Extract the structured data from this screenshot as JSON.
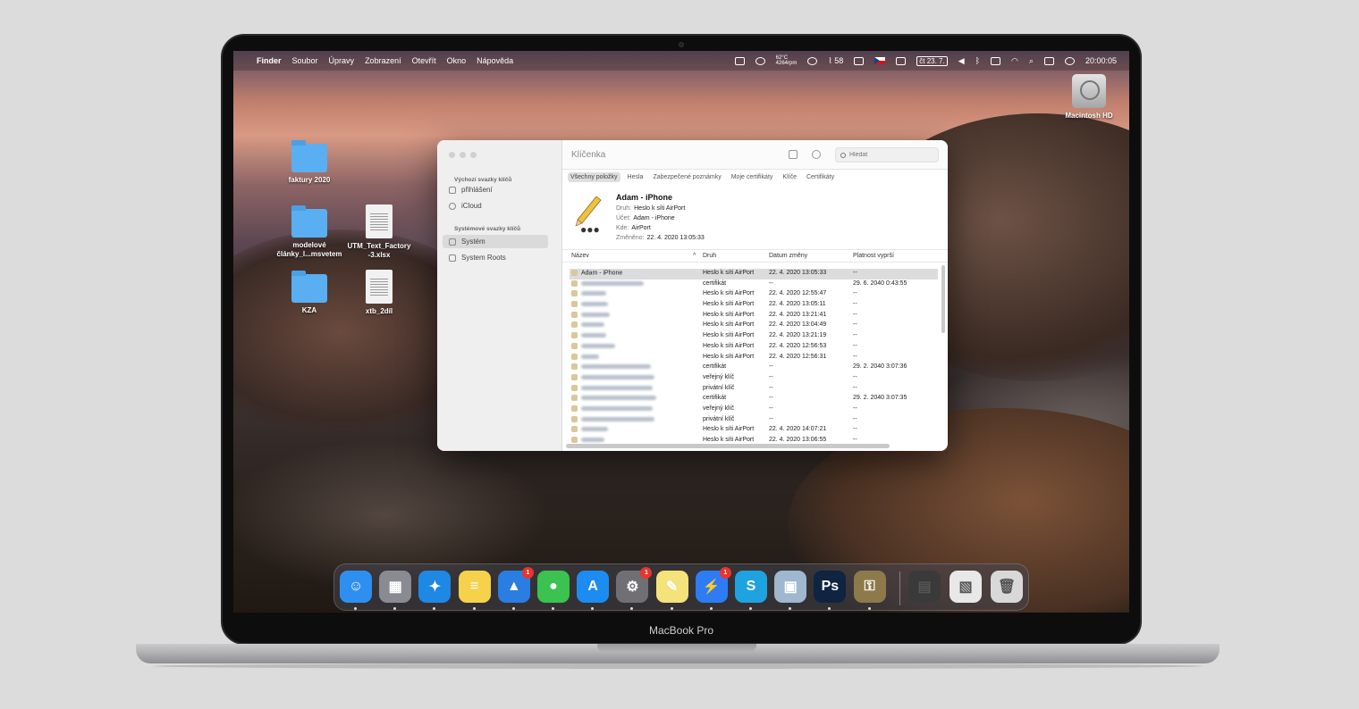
{
  "device": {
    "label": "MacBook Pro"
  },
  "menubar": {
    "apple": "",
    "app": "Finder",
    "menus": [
      "Soubor",
      "Úpravy",
      "Zobrazení",
      "Otevřít",
      "Okno",
      "Nápověda"
    ],
    "temp": "62°C",
    "fan": "4264rpm",
    "stock_value": "58",
    "date": "čt 23. 7.",
    "clock": "20:00:05"
  },
  "desktop_icons": [
    {
      "label": "faktury 2020",
      "kind": "folder"
    },
    {
      "label": "modelové články_l...msvetem",
      "kind": "folder"
    },
    {
      "label": "UTM_Text_Factory -3.xlsx",
      "kind": "document"
    },
    {
      "label": "KZA",
      "kind": "folder"
    },
    {
      "label": "xtb_2díl",
      "kind": "document"
    },
    {
      "label": "Macintosh HD",
      "kind": "disk"
    }
  ],
  "keychain": {
    "title": "Klíčenka",
    "search_placeholder": "Hledat",
    "sidebar": {
      "default_header": "Výchozí svazky klíčů",
      "default_items": [
        "přihlášení",
        "iCloud"
      ],
      "system_header": "Systémové svazky klíčů",
      "system_items": [
        "Systém",
        "System Roots"
      ]
    },
    "tabs": [
      "Všechny položky",
      "Hesla",
      "Zabezpečené poznámky",
      "Moje certifikáty",
      "Klíče",
      "Certifikáty"
    ],
    "detail": {
      "name": "Adam - iPhone",
      "kind_label": "Druh:",
      "kind": "Heslo k síti AirPort",
      "account_label": "Účet:",
      "account": "Adam - iPhone",
      "where_label": "Kde:",
      "where": "AirPort",
      "modified_label": "Změněno:",
      "modified": "22. 4. 2020 13:05:33"
    },
    "columns": [
      "Název",
      "Druh",
      "Datum změny",
      "Platnost vyprší"
    ],
    "rows": [
      {
        "name": "Adam - iPhone",
        "kind": "Heslo k síti AirPort",
        "date": "22. 4. 2020 13:05:33",
        "expires": "--"
      },
      {
        "name": "",
        "kind": "certifikát",
        "date": "--",
        "expires": "29. 6. 2040 0:43:55"
      },
      {
        "name": "",
        "kind": "Heslo k síti AirPort",
        "date": "22. 4. 2020 12:55:47",
        "expires": "--"
      },
      {
        "name": "",
        "kind": "Heslo k síti AirPort",
        "date": "22. 4. 2020 13:05:11",
        "expires": "--"
      },
      {
        "name": "",
        "kind": "Heslo k síti AirPort",
        "date": "22. 4. 2020 13:21:41",
        "expires": "--"
      },
      {
        "name": "",
        "kind": "Heslo k síti AirPort",
        "date": "22. 4. 2020 13:04:49",
        "expires": "--"
      },
      {
        "name": "",
        "kind": "Heslo k síti AirPort",
        "date": "22. 4. 2020 13:21:19",
        "expires": "--"
      },
      {
        "name": "",
        "kind": "Heslo k síti AirPort",
        "date": "22. 4. 2020 12:56:53",
        "expires": "--"
      },
      {
        "name": "",
        "kind": "Heslo k síti AirPort",
        "date": "22. 4. 2020 12:56:31",
        "expires": "--"
      },
      {
        "name": "",
        "kind": "certifikát",
        "date": "--",
        "expires": "29. 2. 2040 3:07:36"
      },
      {
        "name": "",
        "kind": "veřejný klíč",
        "date": "--",
        "expires": "--"
      },
      {
        "name": "",
        "kind": "privátní klíč",
        "date": "--",
        "expires": "--"
      },
      {
        "name": "",
        "kind": "certifikát",
        "date": "--",
        "expires": "29. 2. 2040 3:07:35"
      },
      {
        "name": "",
        "kind": "veřejný klíč",
        "date": "--",
        "expires": "--"
      },
      {
        "name": "",
        "kind": "privátní klíč",
        "date": "--",
        "expires": "--"
      },
      {
        "name": "",
        "kind": "Heslo k síti AirPort",
        "date": "22. 4. 2020 14:07:21",
        "expires": "--"
      },
      {
        "name": "",
        "kind": "Heslo k síti AirPort",
        "date": "22. 4. 2020 13:06:55",
        "expires": "--"
      }
    ]
  },
  "dock": {
    "apps": [
      {
        "name": "finder-app",
        "glyph": "☺",
        "color": "#2f8ff0",
        "badge": ""
      },
      {
        "name": "launchpad-app",
        "glyph": "▦",
        "color": "#8a8a92",
        "badge": ""
      },
      {
        "name": "safari-app",
        "glyph": "✦",
        "color": "#1e88e5",
        "badge": ""
      },
      {
        "name": "notes-app",
        "glyph": "≡",
        "color": "#f6d24c",
        "badge": ""
      },
      {
        "name": "spark-app",
        "glyph": "▲",
        "color": "#2a7de1",
        "badge": "1"
      },
      {
        "name": "messages-app",
        "glyph": "●",
        "color": "#3bc24f",
        "badge": ""
      },
      {
        "name": "app-store-app",
        "glyph": "A",
        "color": "#1c8cf0",
        "badge": ""
      },
      {
        "name": "system-preferences-app",
        "glyph": "⚙",
        "color": "#6f6f74",
        "badge": "1"
      },
      {
        "name": "stickies-app",
        "glyph": "✎",
        "color": "#f4e27a",
        "badge": ""
      },
      {
        "name": "messenger-app",
        "glyph": "⚡",
        "color": "#2d7cf6",
        "badge": "1"
      },
      {
        "name": "skype-app",
        "glyph": "S",
        "color": "#1fa2e0",
        "badge": ""
      },
      {
        "name": "preview-app",
        "glyph": "▣",
        "color": "#9fb7cf",
        "badge": ""
      },
      {
        "name": "photoshop-app",
        "glyph": "Ps",
        "color": "#0e2440",
        "badge": ""
      },
      {
        "name": "keychain-access-app",
        "glyph": "⚿",
        "color": "#8c7a4a",
        "badge": ""
      }
    ],
    "right": [
      {
        "name": "downloads-stack",
        "glyph": "▤",
        "color": "#3a3a3a"
      },
      {
        "name": "screenshot-stack",
        "glyph": "▧",
        "color": "#e8e8e8"
      },
      {
        "name": "trash",
        "glyph": "🗑",
        "color": "#d8d8d8"
      }
    ]
  }
}
